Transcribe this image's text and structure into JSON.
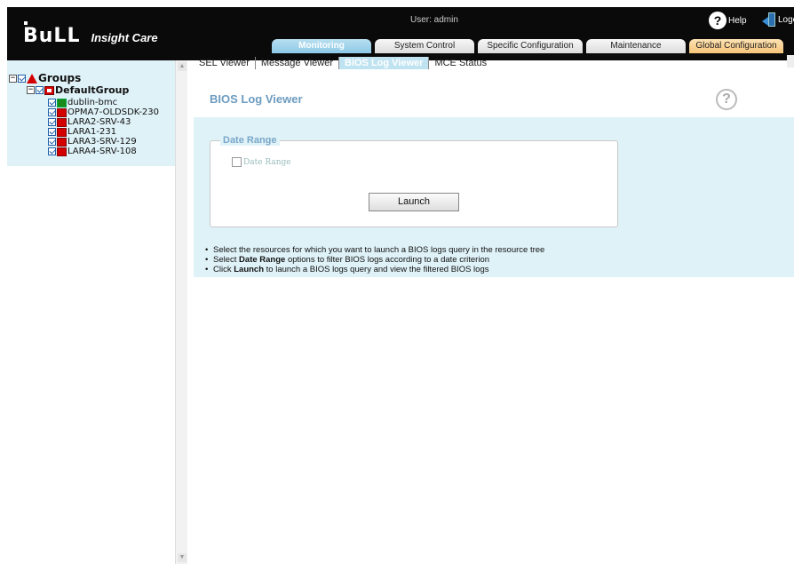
{
  "header": {
    "brand_logo": "BuLL",
    "brand_name": "Insight Care",
    "user_label": "User: admin",
    "help_label": "Help",
    "logout_label": "Logou"
  },
  "main_tabs": [
    {
      "label": "Monitoring",
      "active": true
    },
    {
      "label": "System Control",
      "active": false
    },
    {
      "label": "Specific Configuration",
      "active": false
    },
    {
      "label": "Maintenance",
      "active": false
    },
    {
      "label": "Global Configuration",
      "active": false
    }
  ],
  "sub_tabs": [
    {
      "label": "SEL Viewer",
      "active": false
    },
    {
      "label": "Message Viewer",
      "active": false
    },
    {
      "label": "BIOS Log Viewer",
      "active": true
    },
    {
      "label": "MCE Status",
      "active": false
    }
  ],
  "tree": {
    "root_label": "Groups",
    "group_label": "DefaultGroup",
    "nodes": [
      {
        "label": "dublin-bmc",
        "status": "green"
      },
      {
        "label": "OPMA7-OLDSDK-230",
        "status": "red"
      },
      {
        "label": "LARA2-SRV-43",
        "status": "red"
      },
      {
        "label": "LARA1-231",
        "status": "red"
      },
      {
        "label": "LARA3-SRV-129",
        "status": "red"
      },
      {
        "label": "LARA4-SRV-108",
        "status": "red"
      }
    ]
  },
  "content": {
    "title": "BIOS Log Viewer",
    "fieldset_legend": "Date Range",
    "date_range_checkbox_label": "Date Range",
    "launch_button": "Launch",
    "hints": [
      {
        "pre": "Select the resources for which you want to launch a BIOS logs query in the resource tree",
        "bold": "",
        "post": ""
      },
      {
        "pre": "Select ",
        "bold": "Date Range",
        "post": " options to filter BIOS logs according to a date criterion"
      },
      {
        "pre": "Click ",
        "bold": "Launch",
        "post": " to launch a BIOS logs query and view the filtered BIOS logs"
      }
    ]
  },
  "colors": {
    "header_bg": "#0a0a0a",
    "active_tab": "#8cc9e6",
    "global_tab": "#f6c47a",
    "panel_blue": "#dff2f8",
    "status_red": "#d40000",
    "status_green": "#1a8a1a"
  }
}
